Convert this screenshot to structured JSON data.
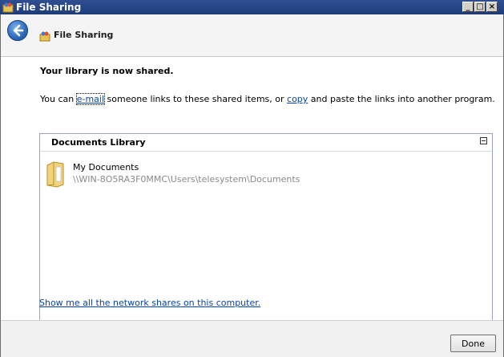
{
  "window": {
    "title": "File Sharing",
    "min_glyph": "_",
    "max_glyph": "□",
    "close_glyph": "×"
  },
  "nav": {
    "title": "File Sharing",
    "back_icon": "back-arrow-icon"
  },
  "main": {
    "heading": "Your library is now shared.",
    "desc_before": "You can ",
    "email_link": "e-mail",
    "desc_middle": " someone links to these shared items, or ",
    "copy_link": "copy",
    "desc_after": " and paste the links into another program."
  },
  "library": {
    "title": "Documents Library",
    "items": [
      {
        "name": "My Documents",
        "path": "\\\\WIN-8O5RA3F0MMC\\Users\\telesystem\\Documents"
      }
    ]
  },
  "shares_link": "Show me all the network shares on this computer.",
  "footer": {
    "done_label": "Done"
  },
  "colors": {
    "titlebar": "#1f3c7a",
    "link": "#0645ad",
    "path_text": "#8a8a8a"
  }
}
